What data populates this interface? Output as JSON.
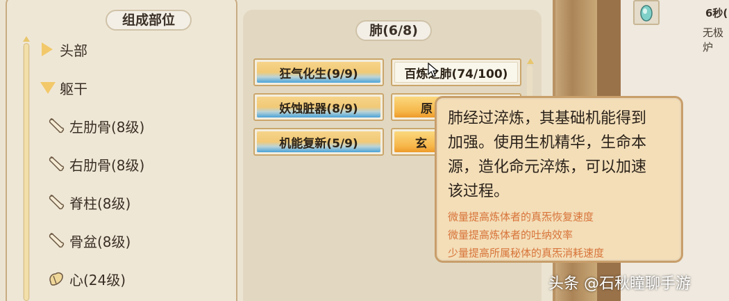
{
  "left_panel": {
    "title": "组成部位",
    "tree": [
      {
        "label": "头部",
        "icon": "expand-right-triangle-icon"
      },
      {
        "label": "躯干",
        "icon": "collapse-down-triangle-icon"
      },
      {
        "label": "左肋骨(8级)",
        "icon": "bone-icon"
      },
      {
        "label": "右肋骨(8级)",
        "icon": "bone-icon"
      },
      {
        "label": "脊柱(8级)",
        "icon": "bone-icon"
      },
      {
        "label": "骨盆(8级)",
        "icon": "bone-icon"
      },
      {
        "label": "心(24级)",
        "icon": "heart-organ-icon"
      }
    ]
  },
  "right_panel": {
    "title": "肺(6/8)",
    "skills": [
      {
        "label": "狂气化生(9/9)",
        "style": "blue"
      },
      {
        "label": "百炼之肺(74/100)",
        "style": "plain"
      },
      {
        "label": "妖蚀脏器(8/9)",
        "style": "blue"
      },
      {
        "label": "原",
        "style": "orange"
      },
      {
        "label": "机能复新(5/9)",
        "style": "blue"
      },
      {
        "label": "玄",
        "style": "orange"
      }
    ]
  },
  "tooltip": {
    "description_lines": [
      "肺经过淬炼，其基础机能得到",
      "加强。使用生机精华，生命本",
      "源，造化命元淬炼，可以加速",
      "该过程。"
    ],
    "effects": [
      "微量提高炼体者的真炁恢复速度",
      "微量提高炼体者的吐纳效率",
      "少量提高所属秘体的真炁消耗速度"
    ]
  },
  "side_panel": {
    "timer": "6秒(",
    "label": "无极炉"
  },
  "watermark": "头条 @石秋瞳聊手游",
  "colors": {
    "panel_bg": "#ece4d2",
    "frame_brown": "#b99264",
    "tooltip_bg": "#f3deb8",
    "effect_text": "#d8743a",
    "button_blue": "#4aa3d9",
    "button_orange": "#f6b74a"
  }
}
